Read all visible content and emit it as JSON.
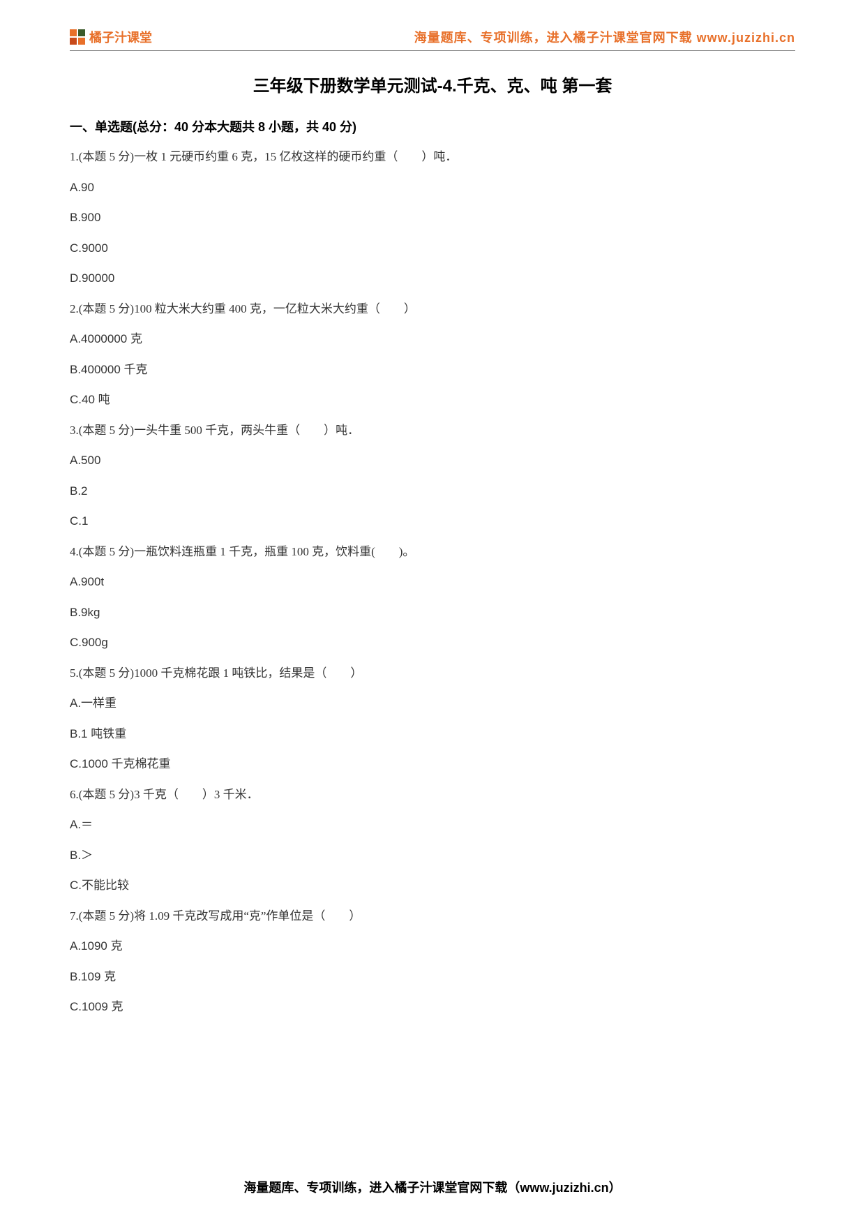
{
  "header": {
    "logo_text": "橘子汁课堂",
    "right_text": "海量题库、专项训练，进入橘子汁课堂官网下载 www.juzizhi.cn"
  },
  "title": "三年级下册数学单元测试-4.千克、克、吨  第一套",
  "section_heading": "一、单选题(总分：40 分本大题共 8 小题，共 40 分)",
  "questions": [
    {
      "text": "1.(本题 5 分)一枚 1 元硬币约重 6 克，15 亿枚这样的硬币约重（　　）吨．",
      "options": [
        "A.90",
        "B.900",
        "C.9000",
        "D.90000"
      ]
    },
    {
      "text": "2.(本题 5 分)100 粒大米大约重 400 克，一亿粒大米大约重（　　）",
      "options": [
        "A.4000000 克",
        "B.400000 千克",
        "C.40 吨"
      ]
    },
    {
      "text": "3.(本题 5 分)一头牛重 500 千克，两头牛重（　　）吨．",
      "options": [
        "A.500",
        "B.2",
        "C.1"
      ]
    },
    {
      "text": "4.(本题 5 分)一瓶饮料连瓶重 1 千克，瓶重 100 克，饮料重(　　)。",
      "options": [
        "A.900t",
        "B.9kg",
        "C.900g"
      ]
    },
    {
      "text": "5.(本题 5 分)1000 千克棉花跟 1 吨铁比，结果是（　　）",
      "options": [
        "A.一样重",
        "B.1 吨铁重",
        "C.1000 千克棉花重"
      ]
    },
    {
      "text": "6.(本题 5 分)3 千克（　　）3 千米．",
      "options": [
        "A.＝",
        "B.＞",
        "C.不能比较"
      ]
    },
    {
      "text": "7.(本题 5 分)将 1.09 千克改写成用“克”作单位是（　　）",
      "options": [
        "A.1090 克",
        "B.109 克",
        "C.1009 克"
      ]
    }
  ],
  "footer": "海量题库、专项训练，进入橘子汁课堂官网下载（www.juzizhi.cn）"
}
